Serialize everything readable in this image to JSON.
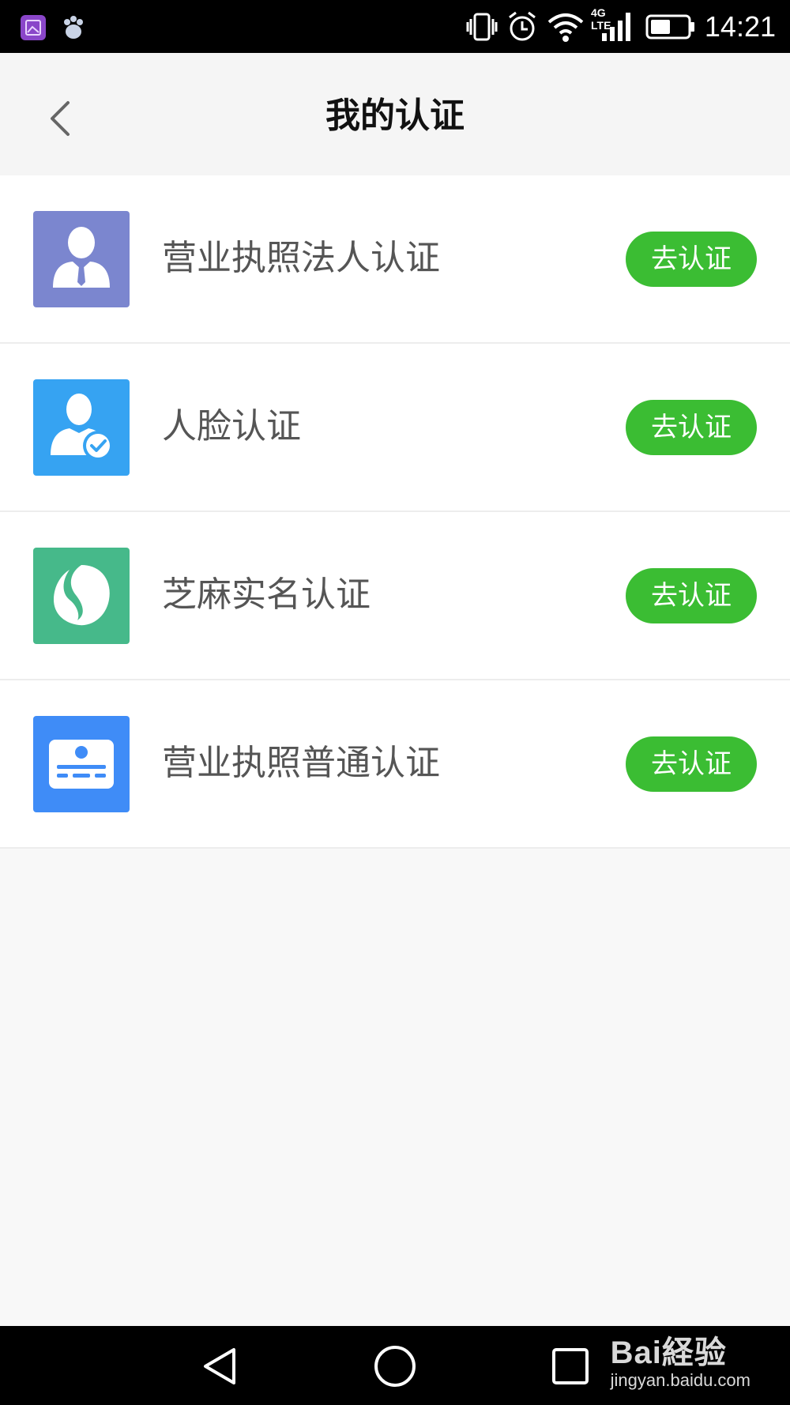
{
  "status_bar": {
    "time": "14:21",
    "network": "4G LTE",
    "icons": [
      "gallery-app-icon",
      "baidu-paw-icon",
      "vibrate-icon",
      "alarm-icon",
      "wifi-icon",
      "signal-icon",
      "battery-icon"
    ]
  },
  "header": {
    "title": "我的认证",
    "back_icon": "chevron-left-icon"
  },
  "auth_items": [
    {
      "label": "营业执照法人认证",
      "button": "去认证",
      "icon": "legal-person-icon",
      "icon_color": "#7b86cf"
    },
    {
      "label": "人脸认证",
      "button": "去认证",
      "icon": "face-verify-icon",
      "icon_color": "#36a3f2"
    },
    {
      "label": "芝麻实名认证",
      "button": "去认证",
      "icon": "sesame-icon",
      "icon_color": "#46b98a"
    },
    {
      "label": "营业执照普通认证",
      "button": "去认证",
      "icon": "id-card-icon",
      "icon_color": "#3f8cf7"
    }
  ],
  "colors": {
    "accent_green": "#3bbd33",
    "header_bg": "#f5f5f5",
    "page_bg": "#f8f8f8"
  },
  "nav_bar": {
    "buttons": [
      "back-triangle-icon",
      "home-circle-icon",
      "recents-square-icon"
    ]
  },
  "watermark": {
    "logo": "Bai経验",
    "url": "jingyan.baidu.com"
  }
}
